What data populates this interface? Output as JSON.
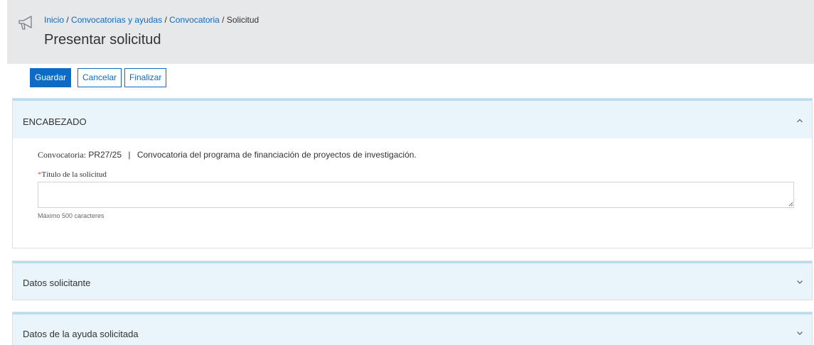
{
  "breadcrumb": {
    "inicio": "Inicio",
    "sep1": " / ",
    "convocatorias": "Convocatorias y ayudas",
    "sep2": " / ",
    "convocatoria": "Convocatoria",
    "sep3": " / ",
    "current": "Solicitud"
  },
  "page_title": "Presentar solicitud",
  "toolbar": {
    "save_label": "Guardar",
    "cancel_label": "Cancelar",
    "finish_label": "Finalizar"
  },
  "sections": {
    "encabezado": {
      "title": "ENCABEZADO",
      "convocatoria_label": "Convocatoria:",
      "convocatoria_code": "PR27/25",
      "separator": "|",
      "convocatoria_desc": "Convocatoria del programa de financiación de proyectos de investigación.",
      "title_field": {
        "required_mark": "*",
        "label": "Título de la solicitud",
        "value": "",
        "hint": "Máximo 500 caracteres"
      }
    },
    "datos_solicitante": {
      "title": "Datos solicitante"
    },
    "datos_ayuda": {
      "title": "Datos de la ayuda solicitada"
    }
  },
  "icons": {
    "megaphone": "megaphone-icon",
    "collapse": "chevron-up-icon",
    "expand": "chevron-down-icon"
  },
  "colors": {
    "accent": "#0b6cc7",
    "panel_header_bg": "#e9f4fb",
    "panel_header_border": "#b5dff0",
    "header_bg": "#e6e8ea",
    "required": "#d9534f"
  }
}
